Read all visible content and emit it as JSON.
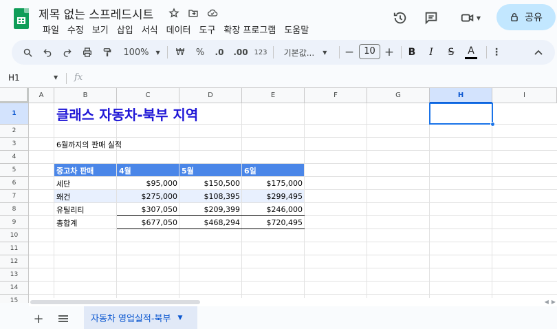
{
  "doc": {
    "title": "제목 없는 스프레드시트"
  },
  "menu": [
    "파일",
    "수정",
    "보기",
    "삽입",
    "서식",
    "데이터",
    "도구",
    "확장 프로그램",
    "도움말"
  ],
  "share": {
    "label": "공유"
  },
  "toolbar": {
    "zoom": "100%",
    "currency": "₩",
    "percent": "%",
    "dec_decrease": ".0",
    "dec_increase": ".00",
    "number_format": "123",
    "font": "기본값...",
    "font_size": "10",
    "minus": "−",
    "plus": "+",
    "bold": "B",
    "italic": "I",
    "strike": "S",
    "textcolor": "A"
  },
  "formula_bar": {
    "name_box": "H1",
    "fx": "fx"
  },
  "columns": [
    "A",
    "B",
    "C",
    "D",
    "E",
    "F",
    "G",
    "H",
    "I"
  ],
  "rows": [
    "1",
    "2",
    "3",
    "4",
    "5",
    "6",
    "7",
    "8",
    "9",
    "10",
    "11",
    "12",
    "13",
    "14",
    "15"
  ],
  "cells": {
    "title": "클래스 자동차-북부 지역",
    "subtitle": "6월까지의 판매 실적",
    "table_header": [
      "중고차 판매",
      "4월",
      "5월",
      "6일"
    ],
    "table_rows": [
      [
        "세단",
        "$95,000",
        "$150,500",
        "$175,000"
      ],
      [
        "왜건",
        "$275,000",
        "$108,395",
        "$299,495"
      ],
      [
        "유틸리티",
        "$307,050",
        "$209,399",
        "$246,000"
      ],
      [
        "총합계",
        "$677,050",
        "$468,294",
        "$720,495"
      ]
    ]
  },
  "sheets": {
    "active": "자동차 영업실적-북부"
  },
  "colors": {
    "header_band": "#4a86e8",
    "title_text": "#1f16d6",
    "stripe": "#e8f0fe",
    "selection": "#1a73e8"
  }
}
